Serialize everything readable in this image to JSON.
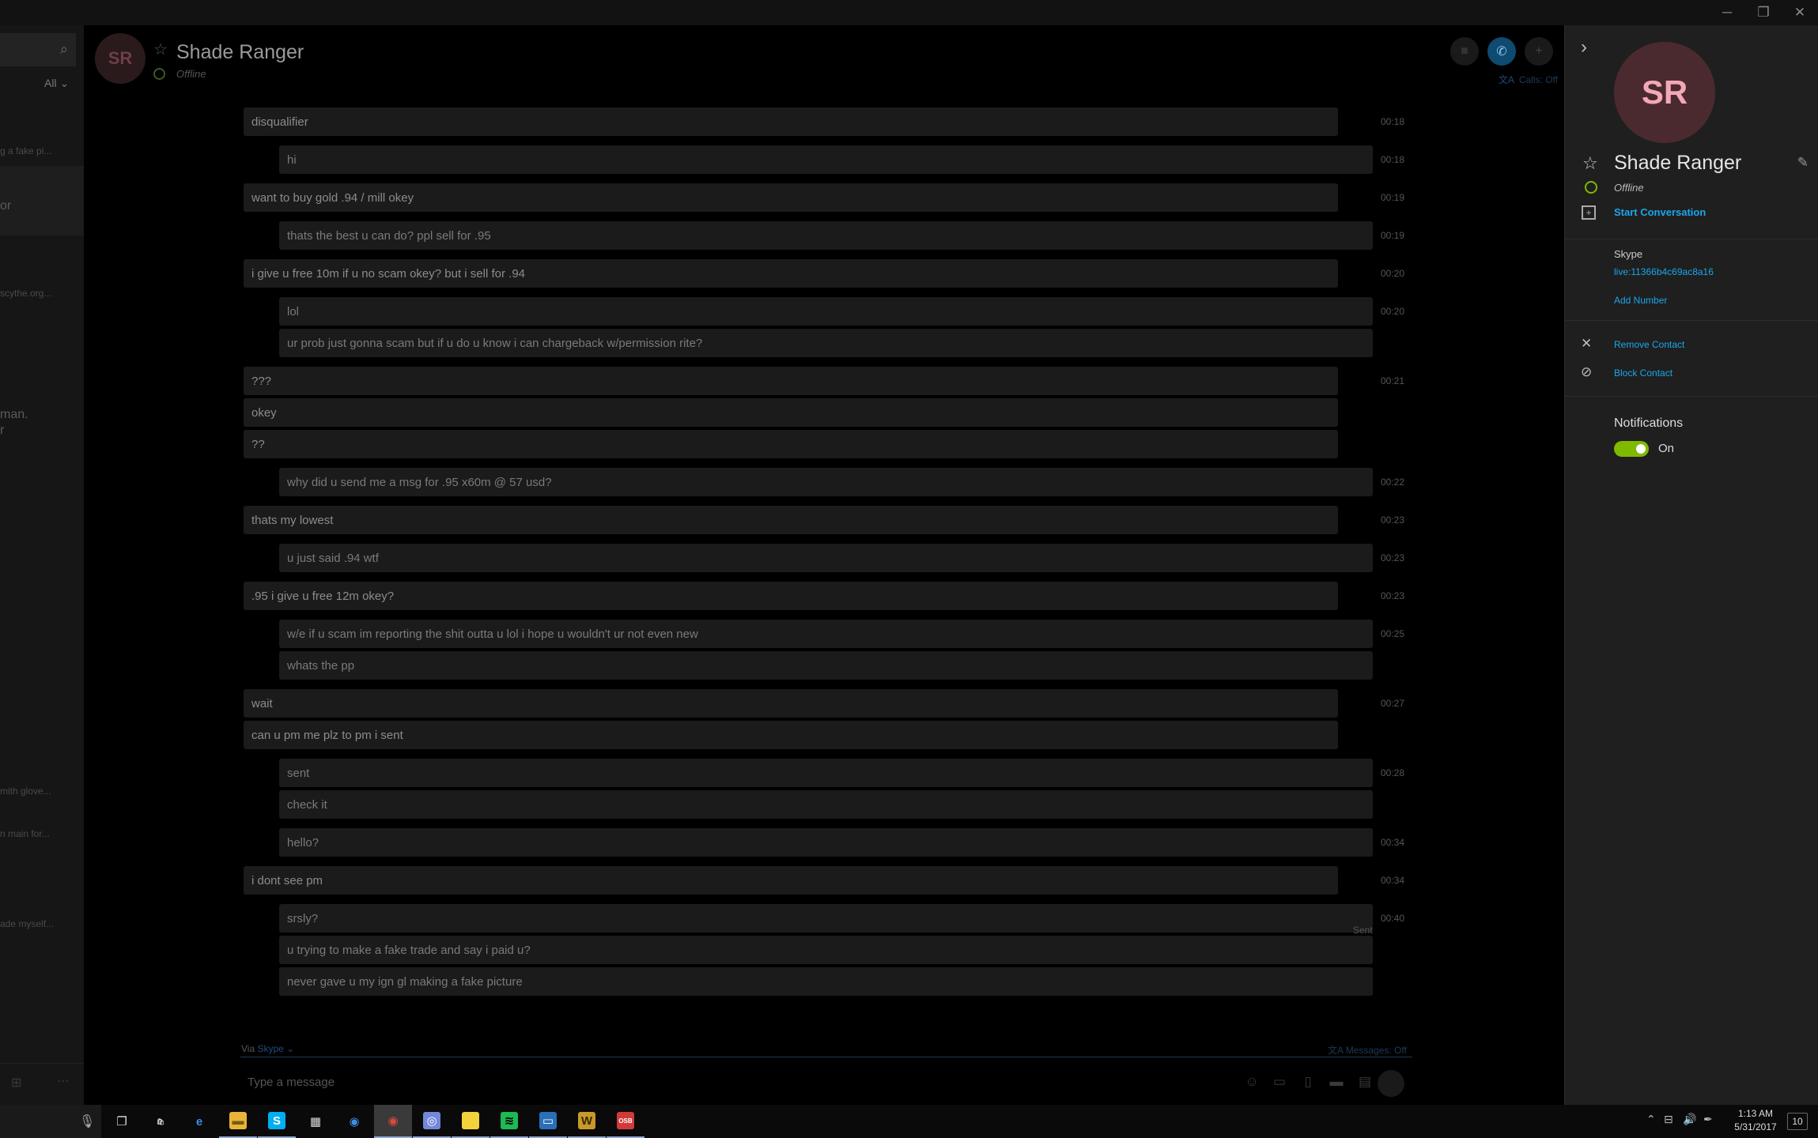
{
  "window": {
    "minimize_glyph": "─",
    "restore_glyph": "❐",
    "close_glyph": "✕"
  },
  "sidebar": {
    "filter_label": "All",
    "snippets": [
      {
        "text": "g a fake pi..."
      },
      {
        "text": "or"
      },
      {
        "text": "scythe.org..."
      },
      {
        "text": "man."
      },
      {
        "text": "r"
      },
      {
        "text": "mith glove..."
      },
      {
        "text": "n main for..."
      },
      {
        "text": "ade myself..."
      }
    ]
  },
  "header": {
    "avatar_initials": "SR",
    "name": "Shade Ranger",
    "status": "Offline",
    "calls_label": "Calls: Off"
  },
  "messages": [
    {
      "dir": "in",
      "text": "disqualifier",
      "time": "00:18"
    },
    {
      "dir": "out",
      "text": "hi",
      "time": "00:18"
    },
    {
      "dir": "in",
      "text": "want to buy gold .94 / mill okey",
      "time": "00:19"
    },
    {
      "dir": "out",
      "text": "thats the best u can do? ppl sell for .95",
      "time": "00:19"
    },
    {
      "dir": "in",
      "text": "i give u free 10m if u no scam okey? but i sell for .94",
      "time": "00:20"
    },
    {
      "dir": "out",
      "text": "lol",
      "time": "00:20"
    },
    {
      "dir": "out",
      "text": "ur prob just gonna scam but if u do u know i can chargeback w/permission rite?",
      "time": ""
    },
    {
      "dir": "in",
      "text": "???",
      "time": "00:21"
    },
    {
      "dir": "in",
      "text": "okey",
      "time": ""
    },
    {
      "dir": "in",
      "text": "??",
      "time": ""
    },
    {
      "dir": "out",
      "text": "why did u send me a msg for .95 x60m @ 57 usd?",
      "time": "00:22"
    },
    {
      "dir": "in",
      "text": "thats my lowest",
      "time": "00:23"
    },
    {
      "dir": "out",
      "text": "u just said .94 wtf",
      "time": "00:23"
    },
    {
      "dir": "in",
      "text": ".95 i give u free 12m okey?",
      "time": "00:23"
    },
    {
      "dir": "out",
      "text": "w/e if u scam im reporting the shit outta u lol i hope u wouldn't ur not even new",
      "time": "00:25"
    },
    {
      "dir": "out",
      "text": "whats the pp",
      "time": ""
    },
    {
      "dir": "in",
      "text": "wait",
      "time": "00:27"
    },
    {
      "dir": "in",
      "text": "can u pm me plz to pm i sent",
      "time": ""
    },
    {
      "dir": "out",
      "text": "sent",
      "time": "00:28"
    },
    {
      "dir": "out",
      "text": "check it",
      "time": ""
    },
    {
      "dir": "out",
      "text": "hello?",
      "time": "00:34"
    },
    {
      "dir": "in",
      "text": "i dont see pm",
      "time": "00:34"
    },
    {
      "dir": "out",
      "text": "srsly?",
      "time": "00:40"
    },
    {
      "dir": "out",
      "text": "u trying to make a fake trade and say i paid u?",
      "time": ""
    },
    {
      "dir": "out",
      "text": "never gave u my ign gl making a fake picture",
      "time": ""
    }
  ],
  "sent_label": "Sent",
  "compose": {
    "via_prefix": "Via",
    "via_service": "Skype",
    "messages_toggle": "Messages: Off",
    "placeholder": "Type a message"
  },
  "profile": {
    "avatar_initials": "SR",
    "name": "Shade Ranger",
    "status": "Offline",
    "start_conversation": "Start Conversation",
    "skype_label": "Skype",
    "skype_id": "live:11366b4c69ac8a16",
    "add_number": "Add Number",
    "remove_contact": "Remove Contact",
    "block_contact": "Block Contact",
    "notifications_label": "Notifications",
    "notifications_state": "On",
    "notifications_on": true
  },
  "taskbar": {
    "apps": [
      {
        "name": "task-view",
        "glyph": "❐",
        "bg": "",
        "color": "#ddd",
        "active": false
      },
      {
        "name": "store",
        "glyph": "🛍",
        "bg": "",
        "color": "#ddd",
        "active": false
      },
      {
        "name": "edge",
        "glyph": "e",
        "bg": "",
        "color": "#3c8ee8",
        "active": false
      },
      {
        "name": "file-explorer",
        "glyph": "▬",
        "bg": "#e8b53a",
        "color": "#7a5a10",
        "active": true
      },
      {
        "name": "skype",
        "glyph": "S",
        "bg": "#00aff0",
        "color": "#fff",
        "active": true
      },
      {
        "name": "calculator",
        "glyph": "▦",
        "bg": "",
        "color": "#ddd",
        "active": false
      },
      {
        "name": "app-blue-circle",
        "glyph": "◉",
        "bg": "",
        "color": "#3c8ee8",
        "active": false
      },
      {
        "name": "chrome",
        "glyph": "◉",
        "bg": "",
        "color": "#e04a3a",
        "active": true
      },
      {
        "name": "discord",
        "glyph": "◎",
        "bg": "#7289da",
        "color": "#fff",
        "active": true
      },
      {
        "name": "sticky-notes",
        "glyph": "",
        "bg": "#f2d33c",
        "color": "#333",
        "active": true
      },
      {
        "name": "spotify",
        "glyph": "≋",
        "bg": "#1db954",
        "color": "#000",
        "active": true
      },
      {
        "name": "app-blue-window",
        "glyph": "▭",
        "bg": "#2a6fb8",
        "color": "#fff",
        "active": true
      },
      {
        "name": "world-of-warcraft",
        "glyph": "W",
        "bg": "#c89a2a",
        "color": "#3a2a00",
        "active": true
      },
      {
        "name": "osbuddy",
        "glyph": "OSB",
        "bg": "#d23a3a",
        "color": "#fff",
        "active": true
      }
    ],
    "time": "1:13 AM",
    "date": "5/31/2017",
    "notification_count": "10"
  }
}
